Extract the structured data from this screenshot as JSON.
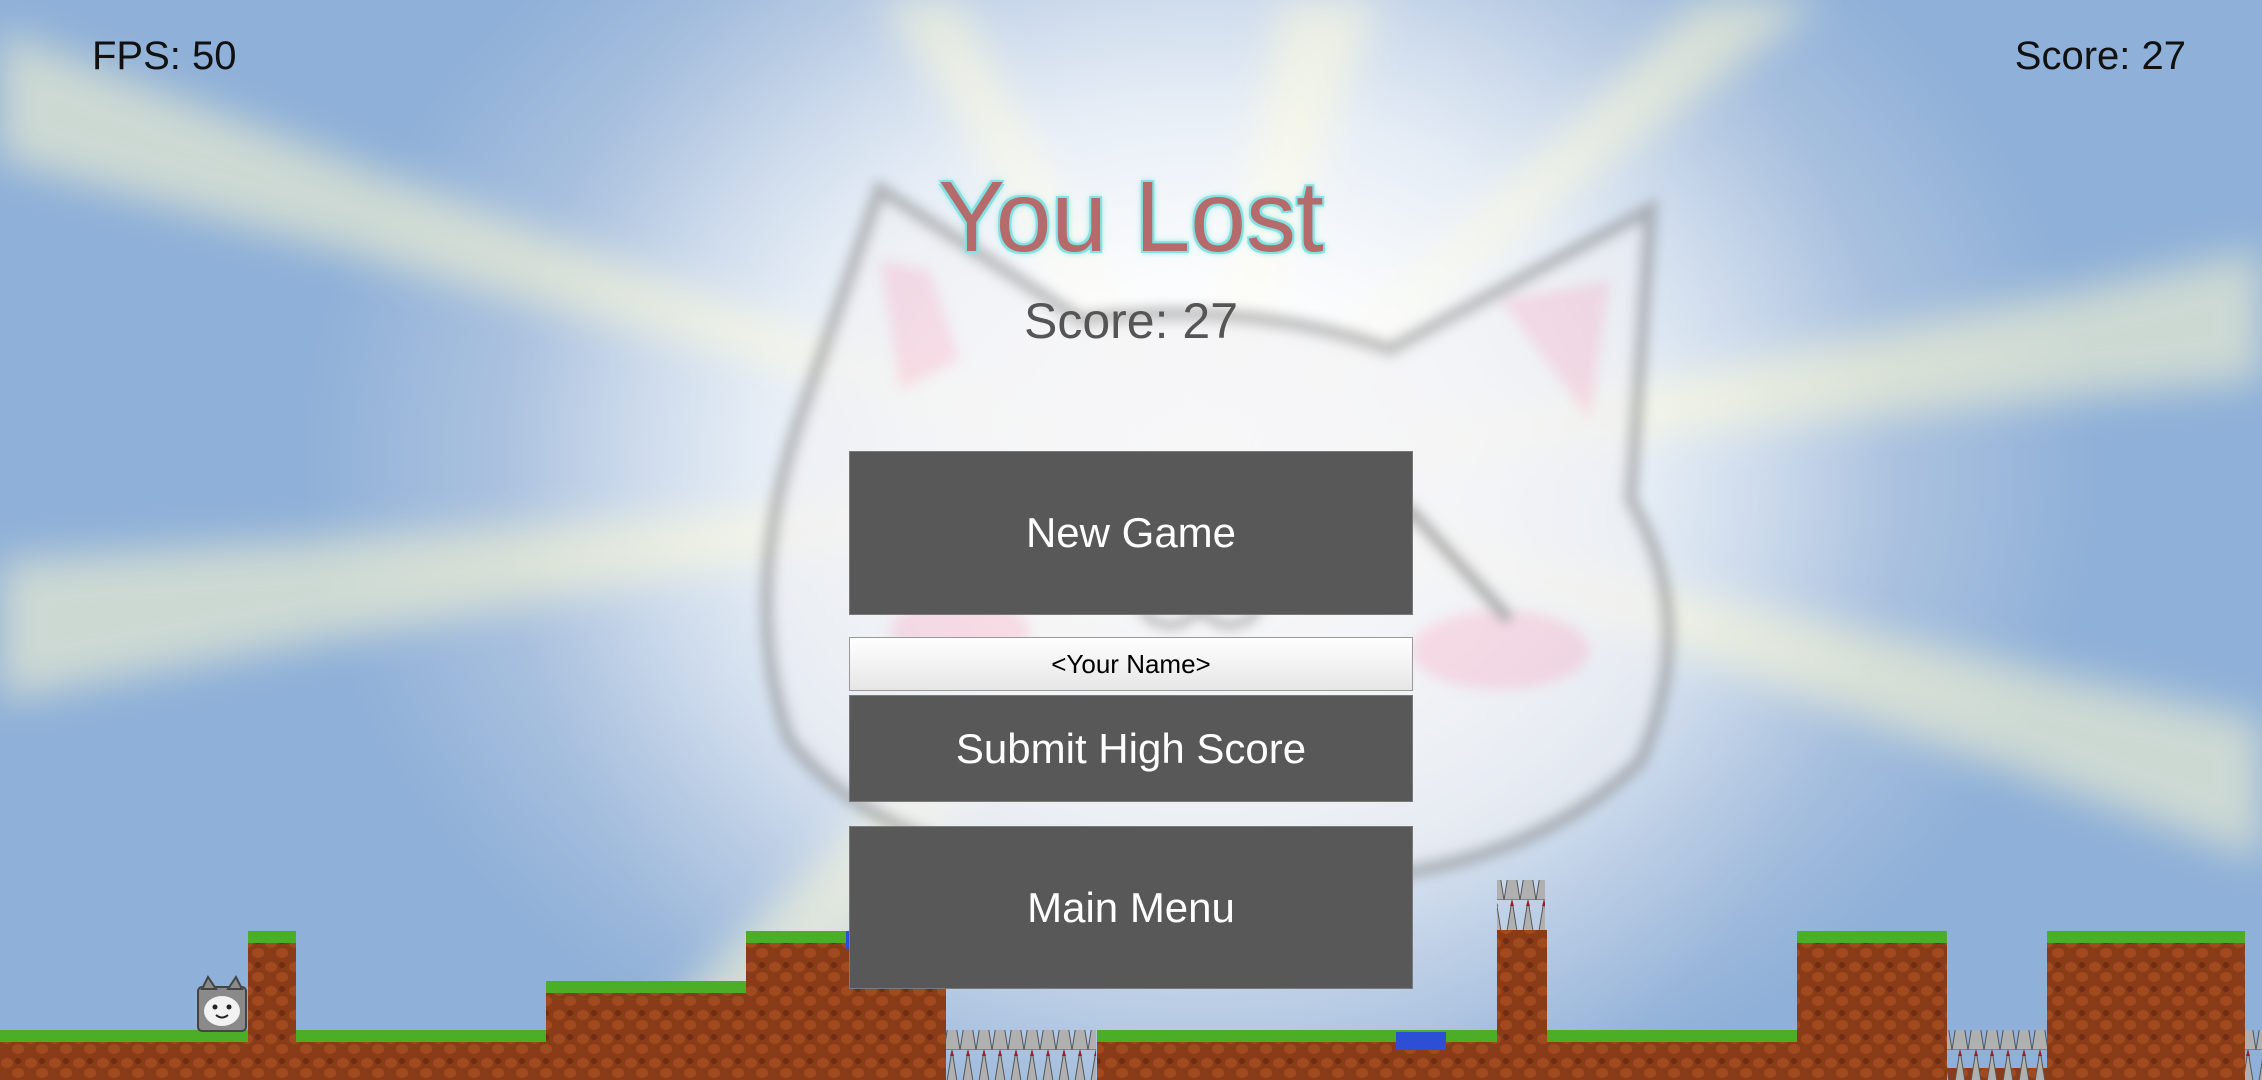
{
  "hud": {
    "fps": "FPS: 50",
    "score": "Score: 27"
  },
  "dialog": {
    "title": "You Lost",
    "score": "Score: 27",
    "new_game": "New Game",
    "name_placeholder": "<Your Name>",
    "submit": "Submit High Score",
    "main_menu": "Main Menu"
  },
  "colors": {
    "button_bg": "#585858",
    "title": "#b56b6b",
    "title_outline": "#7fe0e0",
    "grass": "#4cae26",
    "dirt": "#8a3b18",
    "water": "#2d4fd6",
    "spikes": "#a9a9a9"
  },
  "icons": [
    "cat-player-icon",
    "cat-face-watermark",
    "spike-hazard-icon"
  ]
}
